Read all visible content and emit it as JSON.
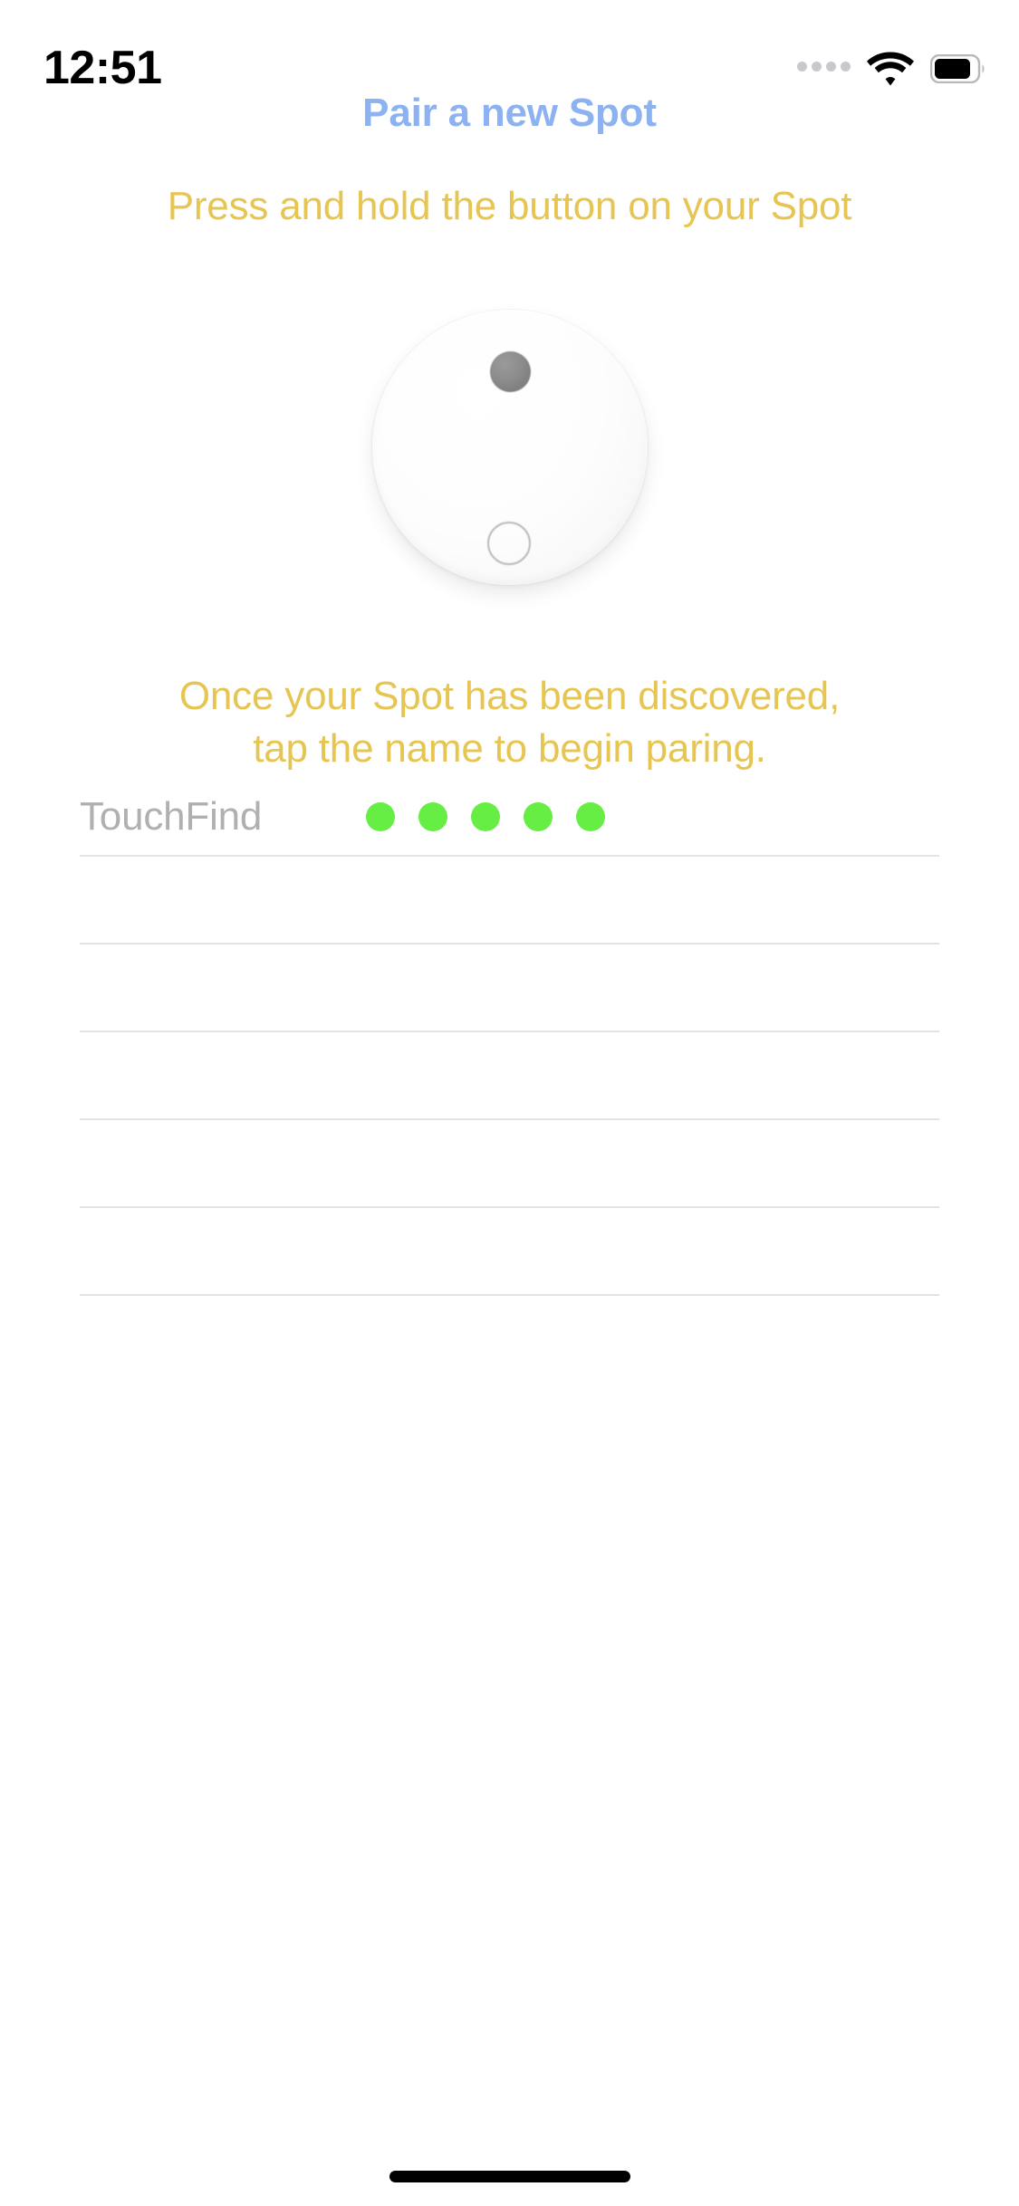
{
  "status_bar": {
    "time": "12:51",
    "signal_icon": "signal-dots-icon",
    "wifi_icon": "wifi-icon",
    "battery_icon": "battery-icon"
  },
  "header": {
    "title": "Pair a new Spot",
    "title_color": "#8cb2f2"
  },
  "instructions": {
    "top": "Press and hold the button on your Spot",
    "bottom_line1": "Once your Spot has been discovered,",
    "bottom_line2": "tap the name to begin paring.",
    "color": "#e7c552"
  },
  "device_illustration": {
    "name": "spot-tracker-illustration",
    "body_color": "#fbfbfb",
    "button_color": "#8c8c8c",
    "led_ring_color": "#b9b9b9"
  },
  "device_list": {
    "rows": [
      {
        "name": "TouchFind",
        "signal_dots": 5,
        "signal_color": "#66ee44"
      },
      {
        "name": "",
        "signal_dots": 0,
        "signal_color": "#66ee44"
      },
      {
        "name": "",
        "signal_dots": 0,
        "signal_color": "#66ee44"
      },
      {
        "name": "",
        "signal_dots": 0,
        "signal_color": "#66ee44"
      },
      {
        "name": "",
        "signal_dots": 0,
        "signal_color": "#66ee44"
      },
      {
        "name": "",
        "signal_dots": 0,
        "signal_color": "#66ee44"
      }
    ]
  },
  "home_indicator": {
    "name": "home-indicator"
  }
}
